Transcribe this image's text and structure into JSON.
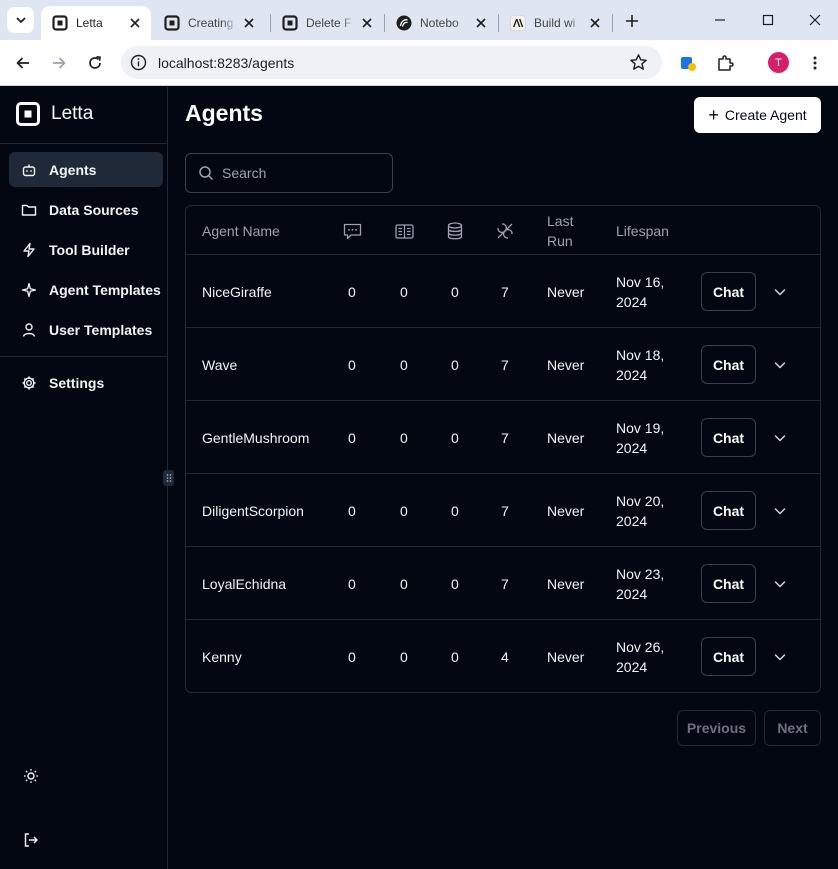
{
  "browser": {
    "tabs": [
      {
        "title": "Letta",
        "icon": "letta-logo-icon",
        "active": true
      },
      {
        "title": "Creating",
        "icon": "letta-logo-icon",
        "active": false
      },
      {
        "title": "Delete F",
        "icon": "letta-logo-icon",
        "active": false
      },
      {
        "title": "Notebo",
        "icon": "notebook-icon",
        "active": false
      },
      {
        "title": "Build wi",
        "icon": "anthropic-icon",
        "active": false
      }
    ],
    "url": "localhost:8283/agents",
    "profile_initial": "T"
  },
  "sidebar": {
    "brand": "Letta",
    "items": [
      {
        "label": "Agents",
        "icon": "bot-icon",
        "active": true
      },
      {
        "label": "Data Sources",
        "icon": "folder-icon",
        "active": false
      },
      {
        "label": "Tool Builder",
        "icon": "bolt-icon",
        "active": false
      },
      {
        "label": "Agent Templates",
        "icon": "sparkle-icon",
        "active": false
      },
      {
        "label": "User Templates",
        "icon": "user-icon",
        "active": false
      }
    ],
    "settings": {
      "label": "Settings",
      "icon": "gear-icon"
    }
  },
  "main": {
    "title": "Agents",
    "create_label": "Create Agent",
    "search_placeholder": "Search",
    "columns": {
      "name": "Agent Name",
      "last_run_line1": "Last",
      "last_run_line2": "Run",
      "lifespan": "Lifespan",
      "icons": [
        "messages-icon",
        "memory-icon",
        "database-icon",
        "tools-icon"
      ]
    },
    "rows": [
      {
        "name": "NiceGiraffe",
        "messages": "0",
        "memory": "0",
        "sources": "0",
        "tools": "7",
        "last_run": "Never",
        "lifespan_1": "Nov 16,",
        "lifespan_2": "2024",
        "chat": "Chat"
      },
      {
        "name": "Wave",
        "messages": "0",
        "memory": "0",
        "sources": "0",
        "tools": "7",
        "last_run": "Never",
        "lifespan_1": "Nov 18,",
        "lifespan_2": "2024",
        "chat": "Chat"
      },
      {
        "name": "GentleMushroom",
        "messages": "0",
        "memory": "0",
        "sources": "0",
        "tools": "7",
        "last_run": "Never",
        "lifespan_1": "Nov 19,",
        "lifespan_2": "2024",
        "chat": "Chat"
      },
      {
        "name": "DiligentScorpion",
        "messages": "0",
        "memory": "0",
        "sources": "0",
        "tools": "7",
        "last_run": "Never",
        "lifespan_1": "Nov 20,",
        "lifespan_2": "2024",
        "chat": "Chat"
      },
      {
        "name": "LoyalEchidna",
        "messages": "0",
        "memory": "0",
        "sources": "0",
        "tools": "7",
        "last_run": "Never",
        "lifespan_1": "Nov 23,",
        "lifespan_2": "2024",
        "chat": "Chat"
      },
      {
        "name": "Kenny",
        "messages": "0",
        "memory": "0",
        "sources": "0",
        "tools": "4",
        "last_run": "Never",
        "lifespan_1": "Nov 26,",
        "lifespan_2": "2024",
        "chat": "Chat"
      }
    ],
    "pagination": {
      "previous": "Previous",
      "next": "Next"
    }
  },
  "colors": {
    "background": "#030712",
    "border": "#1f2937",
    "muted_text": "#9ca3af",
    "active_nav": "#1f2937"
  }
}
